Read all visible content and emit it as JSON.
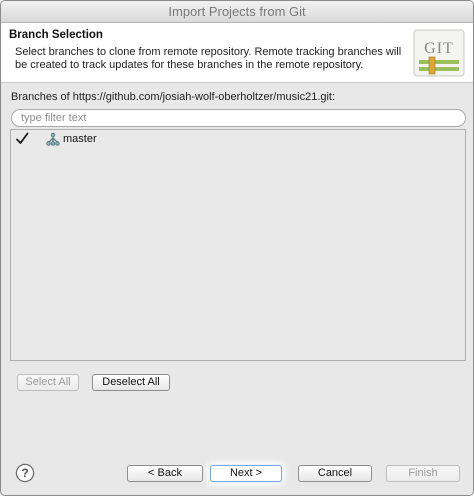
{
  "window": {
    "title": "Import Projects from Git"
  },
  "header": {
    "title": "Branch Selection",
    "description": "Select branches to clone from remote repository. Remote tracking branches will be created to track updates for these branches in the remote repository.",
    "logo_text": "GIT"
  },
  "branches": {
    "label": "Branches of https://github.com/josiah-wolf-oberholtzer/music21.git:",
    "filter_placeholder": "type filter text",
    "items": [
      {
        "name": "master",
        "checked": true,
        "icon": "branch-icon"
      }
    ]
  },
  "selection_buttons": {
    "select_all": "Select All",
    "deselect_all": "Deselect All"
  },
  "footer": {
    "help_icon": "help-icon",
    "back": "< Back",
    "next": "Next >",
    "cancel": "Cancel",
    "finish": "Finish"
  },
  "colors": {
    "accent_focus": "#7aa8e0",
    "logo_green": "#9bbf5a",
    "logo_gold": "#d9a73a"
  }
}
